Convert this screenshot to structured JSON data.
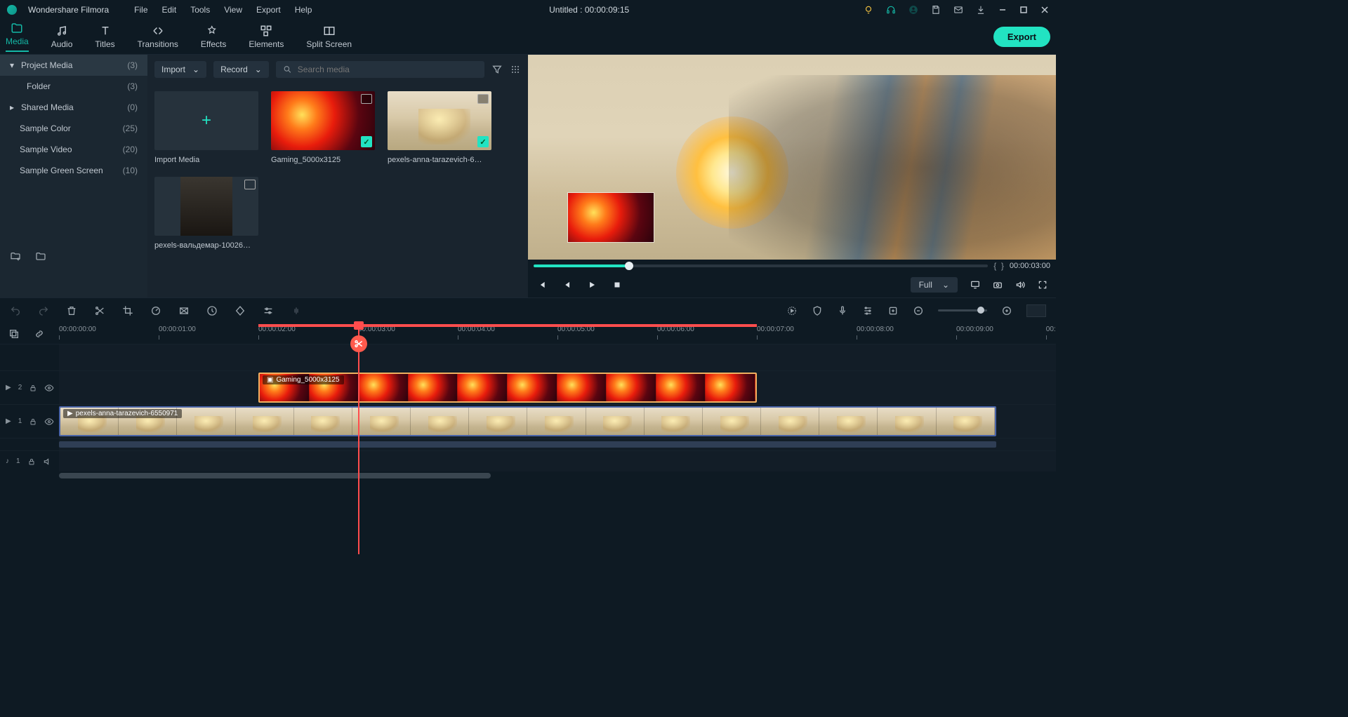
{
  "app": {
    "name": "Wondershare Filmora",
    "title": "Untitled : 00:00:09:15"
  },
  "menu": [
    "File",
    "Edit",
    "Tools",
    "View",
    "Export",
    "Help"
  ],
  "ribbon": {
    "tabs": [
      {
        "label": "Media",
        "active": true
      },
      {
        "label": "Audio"
      },
      {
        "label": "Titles"
      },
      {
        "label": "Transitions"
      },
      {
        "label": "Effects"
      },
      {
        "label": "Elements"
      },
      {
        "label": "Split Screen"
      }
    ],
    "export": "Export"
  },
  "browser": {
    "import_btn": "Import",
    "record_btn": "Record",
    "search_placeholder": "Search media"
  },
  "tree": [
    {
      "name": "Project Media",
      "count": "(3)",
      "selected": true,
      "caret": "▾"
    },
    {
      "name": "Folder",
      "count": "(3)",
      "indent": true
    },
    {
      "name": "Shared Media",
      "count": "(0)",
      "caret": "▸"
    },
    {
      "name": "Sample Color",
      "count": "(25)"
    },
    {
      "name": "Sample Video",
      "count": "(20)"
    },
    {
      "name": "Sample Green Screen",
      "count": "(10)"
    }
  ],
  "thumbs": {
    "import_label": "Import Media",
    "items": [
      {
        "label": "Gaming_5000x3125",
        "kind": "fire",
        "check": true,
        "img": true
      },
      {
        "label": "pexels-anna-tarazevich-6…",
        "kind": "beach",
        "check": true,
        "img": true
      },
      {
        "label": "pexels-вальдемар-10026…",
        "kind": "portrait",
        "vid": true
      }
    ]
  },
  "preview": {
    "time": "00:00:03:00",
    "full": "Full"
  },
  "ruler": {
    "labels": [
      "00:00:00:00",
      "00:00:01:00",
      "00:00:02:00",
      "00:00:03:00",
      "00:00:04:00",
      "00:00:05:00",
      "00:00:06:00",
      "00:00:07:00",
      "00:00:08:00",
      "00:00:09:00",
      "00:"
    ]
  },
  "tracks": {
    "t2": {
      "id": "2",
      "clip_label": "Gaming_5000x3125"
    },
    "t1": {
      "id": "1",
      "clip_label": "pexels-anna-tarazevich-6550971"
    },
    "a1": {
      "id": "1"
    }
  }
}
